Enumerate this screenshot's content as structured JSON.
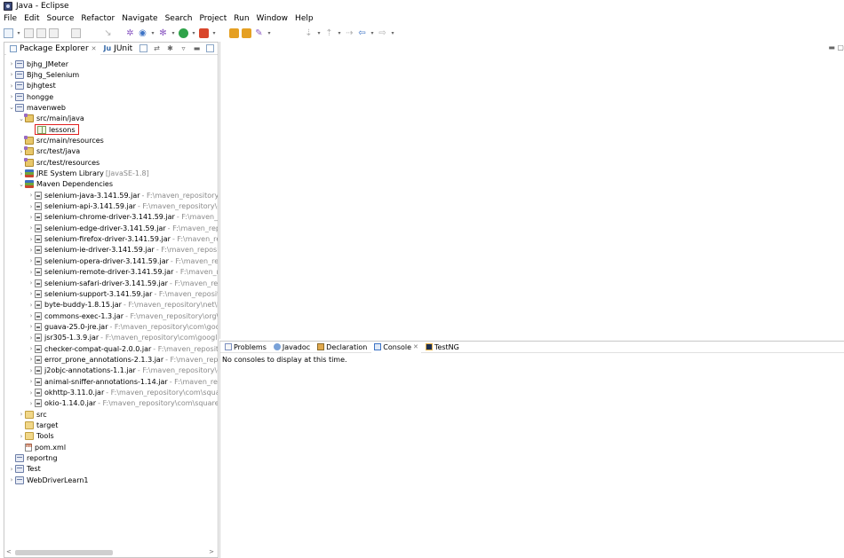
{
  "window": {
    "title": "Java - Eclipse"
  },
  "menu": [
    "File",
    "Edit",
    "Source",
    "Refactor",
    "Navigate",
    "Search",
    "Project",
    "Run",
    "Window",
    "Help"
  ],
  "left_view": {
    "tabs": [
      {
        "label": "Package Explorer",
        "close": "✕"
      },
      {
        "label": "JUnit"
      }
    ],
    "icons": [
      "junit-icon"
    ]
  },
  "tree": [
    {
      "level": 0,
      "expanded": false,
      "icon": "project",
      "label": "bjhg_JMeter"
    },
    {
      "level": 0,
      "expanded": false,
      "icon": "project",
      "label": "Bjhg_Selenium"
    },
    {
      "level": 0,
      "expanded": false,
      "icon": "project",
      "label": "bjhgtest"
    },
    {
      "level": 0,
      "expanded": false,
      "icon": "project",
      "label": "hongge"
    },
    {
      "level": 0,
      "expanded": true,
      "icon": "project",
      "label": "mavenweb"
    },
    {
      "level": 1,
      "expanded": true,
      "icon": "srcfolder",
      "label": "src/main/java"
    },
    {
      "level": 2,
      "expanded": null,
      "icon": "package",
      "label": "lessons",
      "selected": true
    },
    {
      "level": 1,
      "expanded": null,
      "icon": "srcfolder",
      "label": "src/main/resources"
    },
    {
      "level": 1,
      "expanded": false,
      "icon": "srcfolder",
      "label": "src/test/java"
    },
    {
      "level": 1,
      "expanded": null,
      "icon": "srcfolder",
      "label": "src/test/resources"
    },
    {
      "level": 1,
      "expanded": false,
      "icon": "library",
      "label": "JRE System Library",
      "lib_dec": "[JavaSE-1.8]"
    },
    {
      "level": 1,
      "expanded": true,
      "icon": "library",
      "label": "Maven Dependencies"
    },
    {
      "level": 2,
      "expanded": false,
      "icon": "jar",
      "label": "selenium-java-3.141.59.jar",
      "dec": "- F:\\maven_repository\\or"
    },
    {
      "level": 2,
      "expanded": false,
      "icon": "jar",
      "label": "selenium-api-3.141.59.jar",
      "dec": "- F:\\maven_repository\\org"
    },
    {
      "level": 2,
      "expanded": false,
      "icon": "jar",
      "label": "selenium-chrome-driver-3.141.59.jar",
      "dec": "- F:\\maven_rep"
    },
    {
      "level": 2,
      "expanded": false,
      "icon": "jar",
      "label": "selenium-edge-driver-3.141.59.jar",
      "dec": "- F:\\maven_repo"
    },
    {
      "level": 2,
      "expanded": false,
      "icon": "jar",
      "label": "selenium-firefox-driver-3.141.59.jar",
      "dec": "- F:\\maven_repo"
    },
    {
      "level": 2,
      "expanded": false,
      "icon": "jar",
      "label": "selenium-ie-driver-3.141.59.jar",
      "dec": "- F:\\maven_repositor"
    },
    {
      "level": 2,
      "expanded": false,
      "icon": "jar",
      "label": "selenium-opera-driver-3.141.59.jar",
      "dec": "- F:\\maven_repo"
    },
    {
      "level": 2,
      "expanded": false,
      "icon": "jar",
      "label": "selenium-remote-driver-3.141.59.jar",
      "dec": "- F:\\maven_rep"
    },
    {
      "level": 2,
      "expanded": false,
      "icon": "jar",
      "label": "selenium-safari-driver-3.141.59.jar",
      "dec": "- F:\\maven_repo"
    },
    {
      "level": 2,
      "expanded": false,
      "icon": "jar",
      "label": "selenium-support-3.141.59.jar",
      "dec": "- F:\\maven_repositor"
    },
    {
      "level": 2,
      "expanded": false,
      "icon": "jar",
      "label": "byte-buddy-1.8.15.jar",
      "dec": "- F:\\maven_repository\\net\\by"
    },
    {
      "level": 2,
      "expanded": false,
      "icon": "jar",
      "label": "commons-exec-1.3.jar",
      "dec": "- F:\\maven_repository\\org\\a"
    },
    {
      "level": 2,
      "expanded": false,
      "icon": "jar",
      "label": "guava-25.0-jre.jar",
      "dec": "- F:\\maven_repository\\com\\goog"
    },
    {
      "level": 2,
      "expanded": false,
      "icon": "jar",
      "label": "jsr305-1.3.9.jar",
      "dec": "- F:\\maven_repository\\com\\google\\"
    },
    {
      "level": 2,
      "expanded": false,
      "icon": "jar",
      "label": "checker-compat-qual-2.0.0.jar",
      "dec": "- F:\\maven_repositor"
    },
    {
      "level": 2,
      "expanded": false,
      "icon": "jar",
      "label": "error_prone_annotations-2.1.3.jar",
      "dec": "- F:\\maven_repos"
    },
    {
      "level": 2,
      "expanded": false,
      "icon": "jar",
      "label": "j2objc-annotations-1.1.jar",
      "dec": "- F:\\maven_repository\\co"
    },
    {
      "level": 2,
      "expanded": false,
      "icon": "jar",
      "label": "animal-sniffer-annotations-1.14.jar",
      "dec": "- F:\\maven_repo"
    },
    {
      "level": 2,
      "expanded": false,
      "icon": "jar",
      "label": "okhttp-3.11.0.jar",
      "dec": "- F:\\maven_repository\\com\\square"
    },
    {
      "level": 2,
      "expanded": false,
      "icon": "jar",
      "label": "okio-1.14.0.jar",
      "dec": "- F:\\maven_repository\\com\\squareu"
    },
    {
      "level": 1,
      "expanded": false,
      "icon": "folder",
      "label": "src"
    },
    {
      "level": 1,
      "expanded": null,
      "icon": "folder",
      "label": "target"
    },
    {
      "level": 1,
      "expanded": false,
      "icon": "folder",
      "label": "Tools"
    },
    {
      "level": 1,
      "expanded": null,
      "icon": "pom",
      "label": "pom.xml"
    },
    {
      "level": 0,
      "expanded": null,
      "icon": "project",
      "label": "reportng"
    },
    {
      "level": 0,
      "expanded": false,
      "icon": "project",
      "label": "Test"
    },
    {
      "level": 0,
      "expanded": false,
      "icon": "project",
      "label": "WebDriverLearn1"
    }
  ],
  "console": {
    "tabs": [
      {
        "icon": "problems",
        "label": "Problems"
      },
      {
        "icon": "javadoc",
        "label": "Javadoc"
      },
      {
        "icon": "decl",
        "label": "Declaration"
      },
      {
        "icon": "console",
        "label": "Console",
        "close": "✕",
        "active": true
      },
      {
        "icon": "testng",
        "label": "TestNG"
      }
    ],
    "message": "No consoles to display at this time."
  }
}
